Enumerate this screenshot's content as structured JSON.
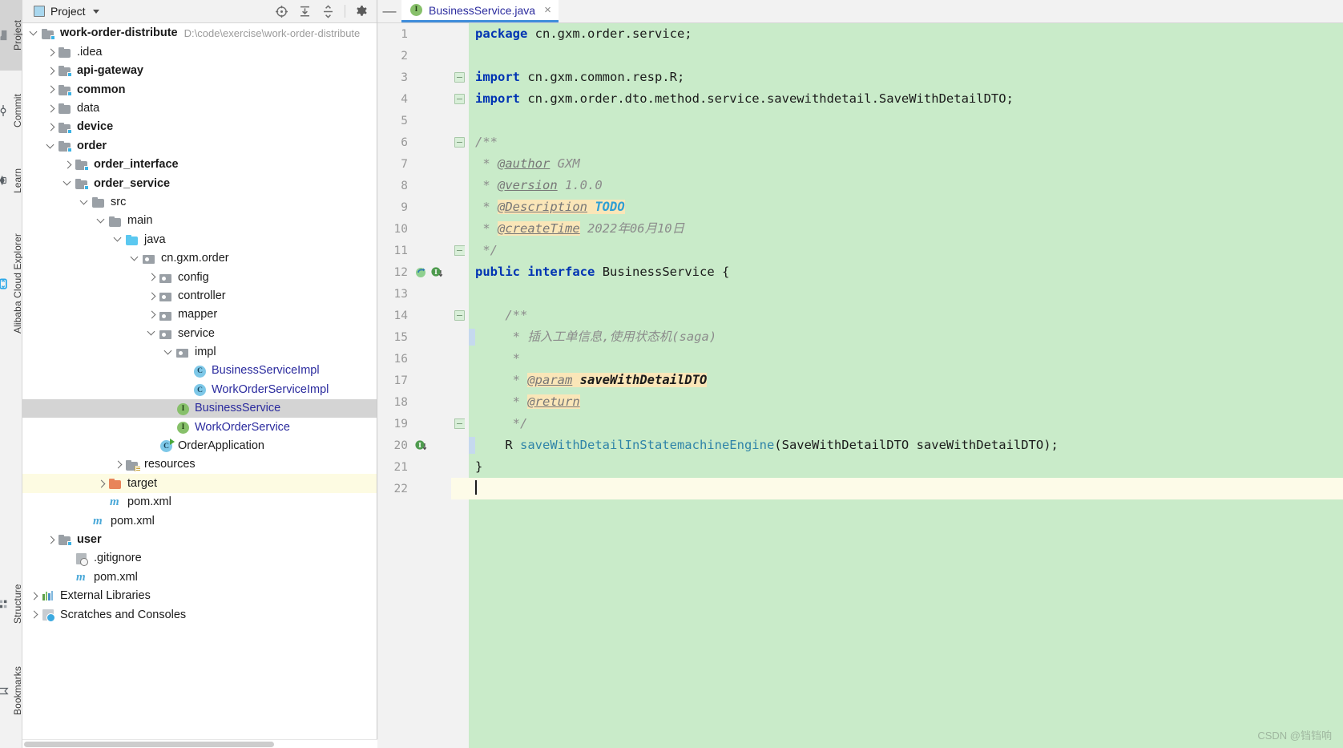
{
  "toolstrip": {
    "left_top": [
      {
        "label": "Project",
        "icon": "project-folder-icon",
        "active": true
      },
      {
        "label": "Commit",
        "icon": "commit-icon",
        "active": false
      },
      {
        "label": "Learn",
        "icon": "graduation-cap-icon",
        "active": false
      },
      {
        "label": "Alibaba Cloud Explorer",
        "icon": "cloud-bracket-icon",
        "active": false
      }
    ],
    "left_bottom": [
      {
        "label": "Structure",
        "icon": "structure-icon",
        "active": false
      },
      {
        "label": "Bookmarks",
        "icon": "bookmark-icon",
        "active": false
      }
    ]
  },
  "panel": {
    "title": "Project",
    "view_icon": "project-view-icon",
    "dropdown_icon": "chevron-down-icon",
    "tools": [
      {
        "name": "select-opened-file-icon",
        "tooltip": "Select Opened File"
      },
      {
        "name": "expand-all-icon",
        "tooltip": "Expand All"
      },
      {
        "name": "collapse-all-icon",
        "tooltip": "Collapse All"
      },
      {
        "name": "settings-gear-icon",
        "tooltip": "Options"
      },
      {
        "name": "minimize-icon",
        "tooltip": "Hide"
      }
    ]
  },
  "tree": [
    {
      "label": "work-order-distribute",
      "hint": "D:\\code\\exercise\\work-order-distribute",
      "indent": 0,
      "arrow": "down",
      "icon": "folder-module",
      "style": "bold"
    },
    {
      "label": ".idea",
      "indent": 1,
      "arrow": "right",
      "icon": "folder-plain",
      "style": "normal"
    },
    {
      "label": "api-gateway",
      "indent": 1,
      "arrow": "right",
      "icon": "folder-module",
      "style": "bold"
    },
    {
      "label": "common",
      "indent": 1,
      "arrow": "right",
      "icon": "folder-module",
      "style": "bold"
    },
    {
      "label": "data",
      "indent": 1,
      "arrow": "right",
      "icon": "folder-plain",
      "style": "normal"
    },
    {
      "label": "device",
      "indent": 1,
      "arrow": "right",
      "icon": "folder-module",
      "style": "bold"
    },
    {
      "label": "order",
      "indent": 1,
      "arrow": "down",
      "icon": "folder-module",
      "style": "bold"
    },
    {
      "label": "order_interface",
      "indent": 2,
      "arrow": "right",
      "icon": "folder-module",
      "style": "bold"
    },
    {
      "label": "order_service",
      "indent": 2,
      "arrow": "down",
      "icon": "folder-module",
      "style": "bold"
    },
    {
      "label": "src",
      "indent": 3,
      "arrow": "down",
      "icon": "folder-plain",
      "style": "normal"
    },
    {
      "label": "main",
      "indent": 4,
      "arrow": "down",
      "icon": "folder-plain",
      "style": "normal"
    },
    {
      "label": "java",
      "indent": 5,
      "arrow": "down",
      "icon": "folder-source",
      "style": "normal"
    },
    {
      "label": "cn.gxm.order",
      "indent": 6,
      "arrow": "down",
      "icon": "folder-package",
      "style": "normal"
    },
    {
      "label": "config",
      "indent": 7,
      "arrow": "right",
      "icon": "folder-package",
      "style": "normal"
    },
    {
      "label": "controller",
      "indent": 7,
      "arrow": "right",
      "icon": "folder-package",
      "style": "normal"
    },
    {
      "label": "mapper",
      "indent": 7,
      "arrow": "right",
      "icon": "folder-package",
      "style": "normal"
    },
    {
      "label": "service",
      "indent": 7,
      "arrow": "down",
      "icon": "folder-package",
      "style": "normal"
    },
    {
      "label": "impl",
      "indent": 8,
      "arrow": "down",
      "icon": "folder-package",
      "style": "normal"
    },
    {
      "label": "BusinessServiceImpl",
      "indent": 9,
      "arrow": "none",
      "icon": "java-class",
      "style": "blue"
    },
    {
      "label": "WorkOrderServiceImpl",
      "indent": 9,
      "arrow": "none",
      "icon": "java-class",
      "style": "blue"
    },
    {
      "label": "BusinessService",
      "indent": 8,
      "arrow": "none",
      "icon": "java-interface",
      "style": "blue",
      "selected": true
    },
    {
      "label": "WorkOrderService",
      "indent": 8,
      "arrow": "none",
      "icon": "java-interface",
      "style": "blue"
    },
    {
      "label": "OrderApplication",
      "indent": 7,
      "arrow": "none",
      "icon": "spring-boot-app",
      "style": "normal"
    },
    {
      "label": "resources",
      "indent": 5,
      "arrow": "right",
      "icon": "folder-resources",
      "style": "normal"
    },
    {
      "label": "target",
      "indent": 4,
      "arrow": "right",
      "icon": "folder-target",
      "style": "normal",
      "highlight": true
    },
    {
      "label": "pom.xml",
      "indent": 4,
      "arrow": "none",
      "icon": "maven-file",
      "style": "normal"
    },
    {
      "label": "pom.xml",
      "indent": 3,
      "arrow": "none",
      "icon": "maven-file",
      "style": "normal"
    },
    {
      "label": "user",
      "indent": 1,
      "arrow": "right",
      "icon": "folder-module",
      "style": "bold"
    },
    {
      "label": ".gitignore",
      "indent": 2,
      "arrow": "none",
      "icon": "gitignore-file",
      "style": "normal"
    },
    {
      "label": "pom.xml",
      "indent": 2,
      "arrow": "none",
      "icon": "maven-file",
      "style": "normal"
    },
    {
      "label": "External Libraries",
      "indent": 0,
      "arrow": "right",
      "icon": "libraries",
      "style": "normal"
    },
    {
      "label": "Scratches and Consoles",
      "indent": 0,
      "arrow": "right",
      "icon": "scratches",
      "style": "normal"
    }
  ],
  "editor": {
    "minimize_label": "—",
    "tabs": [
      {
        "label": "BusinessService.java",
        "icon": "java-interface-icon",
        "close_label": "×",
        "active": true
      }
    ],
    "first_line": 1,
    "last_line": 22,
    "line_numbers": [
      1,
      2,
      3,
      4,
      5,
      6,
      7,
      8,
      9,
      10,
      11,
      12,
      13,
      14,
      15,
      16,
      17,
      18,
      19,
      20,
      21,
      22
    ],
    "gutter_marks": [
      {
        "line": 12,
        "icons": [
          "implemented-by-icon",
          "bean-icon"
        ]
      },
      {
        "line": 20,
        "icons": [
          "bean-icon"
        ]
      }
    ],
    "current_line": 22,
    "code": [
      {
        "n": 1,
        "text": "package cn.gxm.order.service;"
      },
      {
        "n": 2,
        "text": ""
      },
      {
        "n": 3,
        "text": "import cn.gxm.common.resp.R;"
      },
      {
        "n": 4,
        "text": "import cn.gxm.order.dto.method.service.savewithdetail.SaveWithDetailDTO;"
      },
      {
        "n": 5,
        "text": ""
      },
      {
        "n": 6,
        "text": "/**"
      },
      {
        "n": 7,
        "text": " * @author GXM"
      },
      {
        "n": 8,
        "text": " * @version 1.0.0"
      },
      {
        "n": 9,
        "text": " * @Description TODO"
      },
      {
        "n": 10,
        "text": " * @createTime 2022年06月10日"
      },
      {
        "n": 11,
        "text": " */"
      },
      {
        "n": 12,
        "text": "public interface BusinessService {"
      },
      {
        "n": 13,
        "text": ""
      },
      {
        "n": 14,
        "text": "    /**"
      },
      {
        "n": 15,
        "text": "     * 插入工单信息,使用状态机(saga)"
      },
      {
        "n": 16,
        "text": "     *"
      },
      {
        "n": 17,
        "text": "     * @param saveWithDetailDTO"
      },
      {
        "n": 18,
        "text": "     * @return"
      },
      {
        "n": 19,
        "text": "     */"
      },
      {
        "n": 20,
        "text": "    R saveWithDetailInStatemachineEngine(SaveWithDetailDTO saveWithDetailDTO);"
      },
      {
        "n": 21,
        "text": "}"
      },
      {
        "n": 22,
        "text": ""
      }
    ]
  },
  "watermark": "CSDN @铛铛响",
  "colors": {
    "editor_background": "#c9ebc9",
    "current_line": "#fdfbe8",
    "gutter": "#f2f2f2",
    "keyword": "#0033b3",
    "comment": "#8c8c8c",
    "javadoc_tag_highlight": "#fae6b8",
    "todo": "#2f9fd4",
    "method_name": "#2f84a8",
    "tab_underline": "#3f8ddb",
    "tree_selected": "#d4d4d4",
    "tree_target_highlight": "#fdfbe2"
  }
}
